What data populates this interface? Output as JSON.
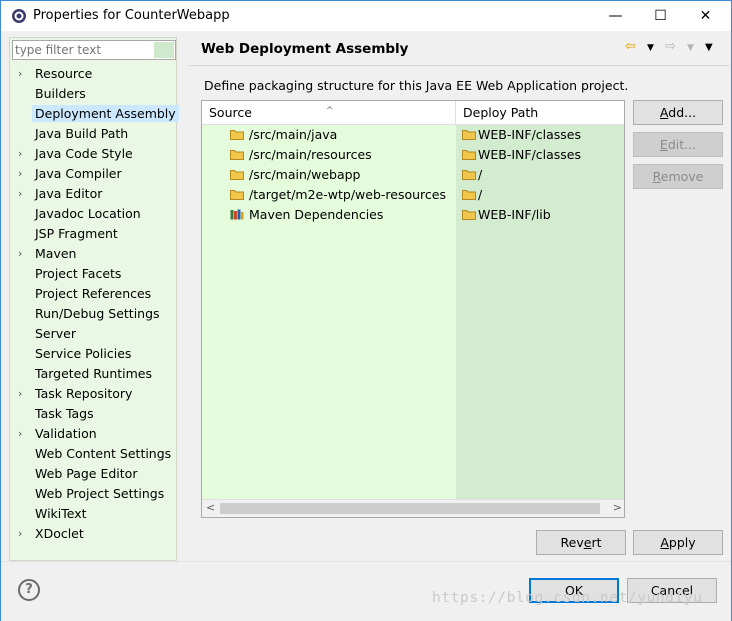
{
  "window": {
    "title": "Properties for CounterWebapp",
    "minimize": "—",
    "maximize": "☐",
    "close": "✕"
  },
  "filter": {
    "placeholder": "type filter text"
  },
  "nav": {
    "items": [
      {
        "label": "Resource",
        "expandable": true
      },
      {
        "label": "Builders",
        "expandable": false
      },
      {
        "label": "Deployment Assembly",
        "expandable": false,
        "selected": true
      },
      {
        "label": "Java Build Path",
        "expandable": false
      },
      {
        "label": "Java Code Style",
        "expandable": true
      },
      {
        "label": "Java Compiler",
        "expandable": true
      },
      {
        "label": "Java Editor",
        "expandable": true
      },
      {
        "label": "Javadoc Location",
        "expandable": false
      },
      {
        "label": "JSP Fragment",
        "expandable": false
      },
      {
        "label": "Maven",
        "expandable": true
      },
      {
        "label": "Project Facets",
        "expandable": false
      },
      {
        "label": "Project References",
        "expandable": false
      },
      {
        "label": "Run/Debug Settings",
        "expandable": false
      },
      {
        "label": "Server",
        "expandable": false
      },
      {
        "label": "Service Policies",
        "expandable": false
      },
      {
        "label": "Targeted Runtimes",
        "expandable": false
      },
      {
        "label": "Task Repository",
        "expandable": true
      },
      {
        "label": "Task Tags",
        "expandable": false
      },
      {
        "label": "Validation",
        "expandable": true
      },
      {
        "label": "Web Content Settings",
        "expandable": false
      },
      {
        "label": "Web Page Editor",
        "expandable": false
      },
      {
        "label": "Web Project Settings",
        "expandable": false
      },
      {
        "label": "WikiText",
        "expandable": false
      },
      {
        "label": "XDoclet",
        "expandable": true
      }
    ]
  },
  "page": {
    "title": "Web Deployment Assembly",
    "description": "Define packaging structure for this Java EE Web Application project."
  },
  "table": {
    "columns": [
      "Source",
      "Deploy Path"
    ],
    "rows": [
      {
        "source": "/src/main/java",
        "deploy": "WEB-INF/classes",
        "icon": "folder-icon"
      },
      {
        "source": "/src/main/resources",
        "deploy": "WEB-INF/classes",
        "icon": "folder-icon"
      },
      {
        "source": "/src/main/webapp",
        "deploy": "/",
        "icon": "folder-icon"
      },
      {
        "source": "/target/m2e-wtp/web-resources",
        "deploy": "/",
        "icon": "folder-icon"
      },
      {
        "source": "Maven Dependencies",
        "deploy": "WEB-INF/lib",
        "icon": "library-icon"
      }
    ],
    "empty_rows": 14
  },
  "buttons": {
    "add": {
      "pre": "",
      "key": "A",
      "post": "dd..."
    },
    "edit": {
      "pre": "",
      "key": "E",
      "post": "dit..."
    },
    "remove": {
      "pre": "",
      "key": "R",
      "post": "emove"
    },
    "revert": {
      "pre": "Rev",
      "key": "e",
      "post": "rt"
    },
    "apply": {
      "pre": "",
      "key": "A",
      "post": "pply"
    },
    "ok": "OK",
    "cancel": "Cancel"
  },
  "help": "?",
  "watermark": "https://blog.csdn.net/yundiyu",
  "colors": {
    "nav_bg": "#e9f7e4",
    "source_cell_bg": "#e4fbdc",
    "deploy_cell_bg": "#d3ecd0",
    "selection": "#cce8ff",
    "folder": "#f2c54b"
  }
}
